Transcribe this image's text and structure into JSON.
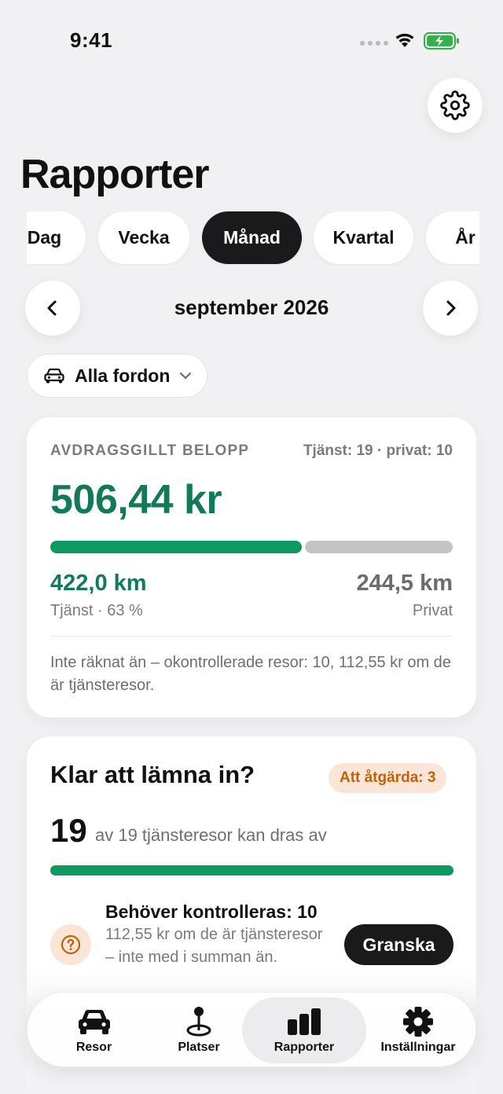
{
  "status_bar": {
    "time": "9:41"
  },
  "header": {
    "title": "Rapporter",
    "settings_icon": "gear-icon"
  },
  "period_tabs": [
    {
      "label": "Dag",
      "active": false
    },
    {
      "label": "Vecka",
      "active": false
    },
    {
      "label": "Månad",
      "active": true
    },
    {
      "label": "Kvartal",
      "active": false
    },
    {
      "label": "År",
      "active": false
    }
  ],
  "period_nav": {
    "label": "september 2026",
    "prev_icon": "chevron-left-icon",
    "next_icon": "chevron-right-icon"
  },
  "vehicle_filter": {
    "label": "Alla fordon",
    "icon": "car-icon"
  },
  "summary": {
    "label": "AVDRAGSGILLT BELOPP",
    "split": "Tjänst: 19 · privat: 10",
    "amount": "506,44 kr",
    "business_share": 0.63,
    "business_km": "422,0 km",
    "business_sub": "Tjänst · 63 %",
    "private_km": "244,5 km",
    "private_sub": "Privat",
    "note": "Inte räknat än – okontrollerade resor: 10, 112,55 kr om de är tjänsteresor."
  },
  "ready": {
    "title": "Klar att lämna in?",
    "badge": "Att åtgärda: 3",
    "count": "19",
    "count_text": "av 19 tjänsteresor kan dras av",
    "progress": 1.0,
    "review": {
      "title": "Behöver kontrolleras: 10",
      "description": "112,55 kr om de är tjänsteresor – inte med i summan än.",
      "button": "Granska"
    }
  },
  "tab_bar": [
    {
      "label": "Resor",
      "icon": "car-icon",
      "active": false
    },
    {
      "label": "Platser",
      "icon": "map-pin-icon",
      "active": false
    },
    {
      "label": "Rapporter",
      "icon": "bar-chart-icon",
      "active": true
    },
    {
      "label": "Inställningar",
      "icon": "gear-icon",
      "active": false
    }
  ],
  "colors": {
    "accent_green": "#127a56",
    "bar_green": "#0c9a62",
    "warning_orange": "#c0620c",
    "dark": "#1a1a1c"
  }
}
